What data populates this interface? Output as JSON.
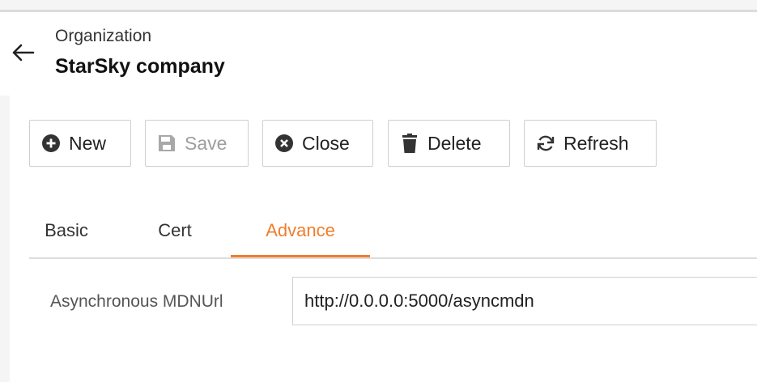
{
  "header": {
    "section_label": "Organization",
    "title": "StarSky company"
  },
  "toolbar": {
    "buttons": [
      {
        "label": "New",
        "icon": "plus-circle-icon",
        "enabled": true
      },
      {
        "label": "Save",
        "icon": "save-icon",
        "enabled": false
      },
      {
        "label": "Close",
        "icon": "close-circle-icon",
        "enabled": true
      },
      {
        "label": "Delete",
        "icon": "trash-icon",
        "enabled": true
      },
      {
        "label": "Refresh",
        "icon": "refresh-icon",
        "enabled": true
      }
    ]
  },
  "tabs": [
    {
      "label": "Basic",
      "active": false
    },
    {
      "label": "Cert",
      "active": false
    },
    {
      "label": "Advance",
      "active": true
    }
  ],
  "form": {
    "async_mdn_url_label": "Asynchronous MDNUrl",
    "async_mdn_url_value": "http://0.0.0.0:5000/asyncmdn"
  },
  "colors": {
    "accent": "#f07d2d",
    "background": "#f5f5f5",
    "panel": "#ffffff",
    "disabled_text": "#9e9e9e"
  }
}
